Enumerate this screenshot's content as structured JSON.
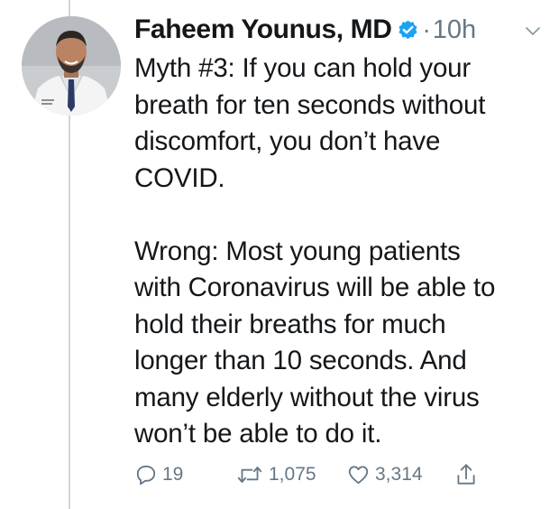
{
  "tweet": {
    "author_name": "Faheem Younus, MD",
    "separator": "·",
    "time": "10h",
    "text_paragraph_1": "Myth #3: If you can hold your\nbreath for ten seconds without\ndiscomfort, you don’t have\nCOVID.",
    "text_paragraph_2": "Wrong: Most young patients\nwith Coronavirus will be able to\nhold their breaths for much\nlonger than 10 seconds. And\nmany elderly without the virus\nwon’t be able to do it."
  },
  "actions": {
    "reply_count": "19",
    "retweet_count": "1,075",
    "like_count": "3,314"
  },
  "icons": {
    "verified": "verified-badge-icon",
    "menu": "chevron-down-icon",
    "reply": "reply-icon",
    "retweet": "retweet-icon",
    "like": "heart-icon",
    "share": "share-icon"
  },
  "colors": {
    "verified_blue": "#1da1f2",
    "text": "#14171a",
    "secondary": "#657786"
  }
}
